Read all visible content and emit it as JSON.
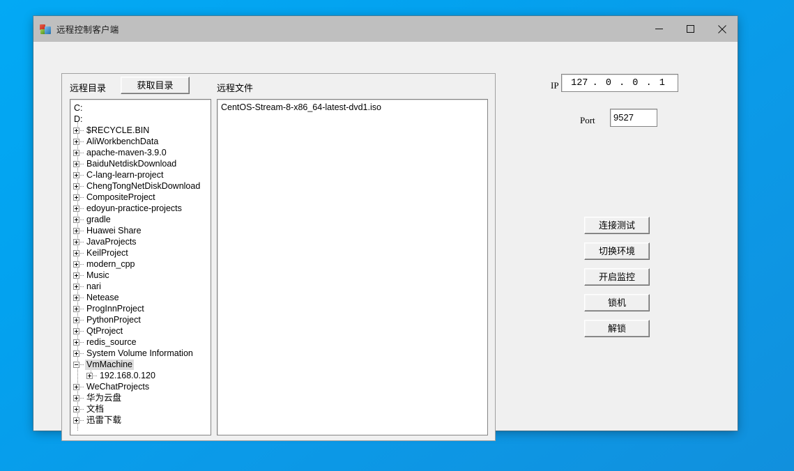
{
  "window": {
    "title": "远程控制客户端",
    "icon": "app-blocks-icon",
    "controls": {
      "minimize": "minimize-icon",
      "maximize": "maximize-icon",
      "close": "close-icon"
    }
  },
  "browser_panel": {
    "remote_dir_label": "远程目录",
    "fetch_dir_button": "获取目录",
    "remote_file_label": "远程文件"
  },
  "tree": {
    "nodes": [
      {
        "label": "C:",
        "level": 0,
        "expander": "none"
      },
      {
        "label": "D:",
        "level": 0,
        "expander": "none"
      },
      {
        "label": "$RECYCLE.BIN",
        "level": 1,
        "expander": "plus"
      },
      {
        "label": "AliWorkbenchData",
        "level": 1,
        "expander": "plus"
      },
      {
        "label": "apache-maven-3.9.0",
        "level": 1,
        "expander": "plus"
      },
      {
        "label": "BaiduNetdiskDownload",
        "level": 1,
        "expander": "plus"
      },
      {
        "label": "C-lang-learn-project",
        "level": 1,
        "expander": "plus"
      },
      {
        "label": "ChengTongNetDiskDownload",
        "level": 1,
        "expander": "plus"
      },
      {
        "label": "CompositeProject",
        "level": 1,
        "expander": "plus"
      },
      {
        "label": "edoyun-practice-projects",
        "level": 1,
        "expander": "plus"
      },
      {
        "label": "gradle",
        "level": 1,
        "expander": "plus"
      },
      {
        "label": "Huawei Share",
        "level": 1,
        "expander": "plus"
      },
      {
        "label": "JavaProjects",
        "level": 1,
        "expander": "plus"
      },
      {
        "label": "KeilProject",
        "level": 1,
        "expander": "plus"
      },
      {
        "label": "modern_cpp",
        "level": 1,
        "expander": "plus"
      },
      {
        "label": "Music",
        "level": 1,
        "expander": "plus"
      },
      {
        "label": "nari",
        "level": 1,
        "expander": "plus"
      },
      {
        "label": "Netease",
        "level": 1,
        "expander": "plus"
      },
      {
        "label": "ProgInnProject",
        "level": 1,
        "expander": "plus"
      },
      {
        "label": "PythonProject",
        "level": 1,
        "expander": "plus"
      },
      {
        "label": "QtProject",
        "level": 1,
        "expander": "plus"
      },
      {
        "label": "redis_source",
        "level": 1,
        "expander": "plus"
      },
      {
        "label": "System Volume Information",
        "level": 1,
        "expander": "plus"
      },
      {
        "label": "VmMachine",
        "level": 1,
        "expander": "minus",
        "selected": true
      },
      {
        "label": "192.168.0.120",
        "level": 2,
        "expander": "plus"
      },
      {
        "label": "WeChatProjects",
        "level": 1,
        "expander": "plus"
      },
      {
        "label": "华为云盘",
        "level": 1,
        "expander": "plus"
      },
      {
        "label": "文档",
        "level": 1,
        "expander": "plus"
      },
      {
        "label": "迅雷下载",
        "level": 1,
        "expander": "plus"
      }
    ]
  },
  "file_list": {
    "items": [
      "CentOS-Stream-8-x86_64-latest-dvd1.iso"
    ]
  },
  "connection": {
    "ip_label": "IP",
    "ip_octets": [
      "127",
      "0",
      "0",
      "1"
    ],
    "ip_separator": ".",
    "port_label": "Port",
    "port_value": "9527"
  },
  "actions": {
    "buttons": [
      "连接测试",
      "切换环境",
      "开启监控",
      "锁机",
      "解锁"
    ]
  },
  "colors": {
    "desktop": "#03a9f4",
    "titlebar": "#bfbfbf",
    "client": "#f0f0f0",
    "selection": "#dcdcdc"
  }
}
